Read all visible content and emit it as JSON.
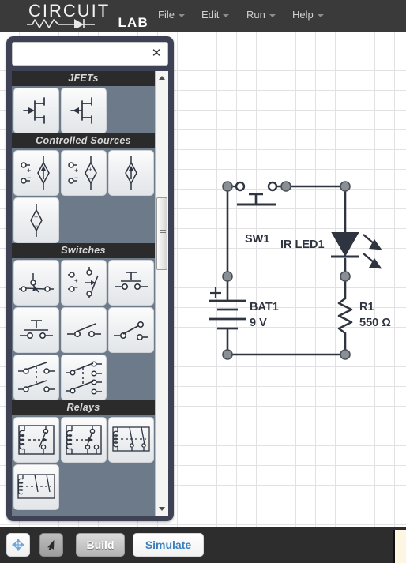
{
  "app": {
    "logo_top": "CIRCUIT",
    "logo_bottom": "LAB",
    "logo_icon": "resistor-diode-icon"
  },
  "menu": {
    "items": [
      {
        "label": "File",
        "caret": "chevron-down-icon"
      },
      {
        "label": "Edit",
        "caret": "chevron-down-icon"
      },
      {
        "label": "Run",
        "caret": "chevron-down-icon"
      },
      {
        "label": "Help",
        "caret": "chevron-down-icon"
      }
    ]
  },
  "palette": {
    "search": {
      "value": "",
      "placeholder": ""
    },
    "close_label": "✕",
    "scrollbar": {
      "up_icon": "triangle-up-icon",
      "down_icon": "triangle-down-icon"
    },
    "categories": [
      {
        "name": "JFETs",
        "components": [
          {
            "name": "n-channel-jfet",
            "symbol": "jfet-n"
          },
          {
            "name": "p-channel-jfet",
            "symbol": "jfet-p"
          }
        ]
      },
      {
        "name": "Controlled Sources",
        "components": [
          {
            "name": "voltage-controlled-current-source",
            "symbol": "vccs"
          },
          {
            "name": "voltage-controlled-voltage-source",
            "symbol": "vcvs"
          },
          {
            "name": "current-controlled-current-source",
            "symbol": "cccs"
          },
          {
            "name": "current-controlled-voltage-source",
            "symbol": "ccvs"
          }
        ]
      },
      {
        "name": "Switches",
        "components": [
          {
            "name": "voltage-controlled-switch",
            "symbol": "sw-vctrl"
          },
          {
            "name": "analog-switch",
            "symbol": "sw-analog"
          },
          {
            "name": "pushbutton-normally-open",
            "symbol": "sw-push-no"
          },
          {
            "name": "pushbutton-normally-closed",
            "symbol": "sw-push-nc"
          },
          {
            "name": "spst-switch",
            "symbol": "sw-spst-open"
          },
          {
            "name": "spst-switch-closed",
            "symbol": "sw-spst-closed"
          },
          {
            "name": "dpst-switch",
            "symbol": "sw-dpst"
          },
          {
            "name": "dpdt-switch",
            "symbol": "sw-dpdt"
          }
        ]
      },
      {
        "name": "Relays",
        "components": [
          {
            "name": "spst-relay",
            "symbol": "relay-spst"
          },
          {
            "name": "spdt-relay",
            "symbol": "relay-spdt"
          },
          {
            "name": "dpst-relay",
            "symbol": "relay-dpst"
          },
          {
            "name": "dpdt-relay",
            "symbol": "relay-dpdt"
          }
        ]
      }
    ]
  },
  "schematic": {
    "components": [
      {
        "id": "SW1",
        "label": "SW1",
        "value": "",
        "type": "pushbutton"
      },
      {
        "id": "IR LED1",
        "label": "IR LED1",
        "value": "",
        "type": "led"
      },
      {
        "id": "BAT1",
        "label": "BAT1",
        "value": "9 V",
        "type": "battery"
      },
      {
        "id": "R1",
        "label": "R1",
        "value": "550 Ω",
        "type": "resistor"
      }
    ],
    "labels": {
      "sw1": "SW1",
      "led1": "IR LED1",
      "bat1": "BAT1",
      "bat1_value": "9 V",
      "r1": "R1",
      "r1_value": "550 Ω"
    }
  },
  "toolbar": {
    "pan_icon": "move-arrows-icon",
    "select_icon": "cursor-arrow-icon",
    "build_label": "Build",
    "simulate_label": "Simulate"
  },
  "colors": {
    "topbar": "#3a3a3a",
    "panel": "#3e4254",
    "panel_body": "#6c7a8a",
    "category_header": "#2b2b2b",
    "wire": "#2e3440",
    "node": "#8a8f96",
    "simulate_text": "#3a7fbf"
  }
}
